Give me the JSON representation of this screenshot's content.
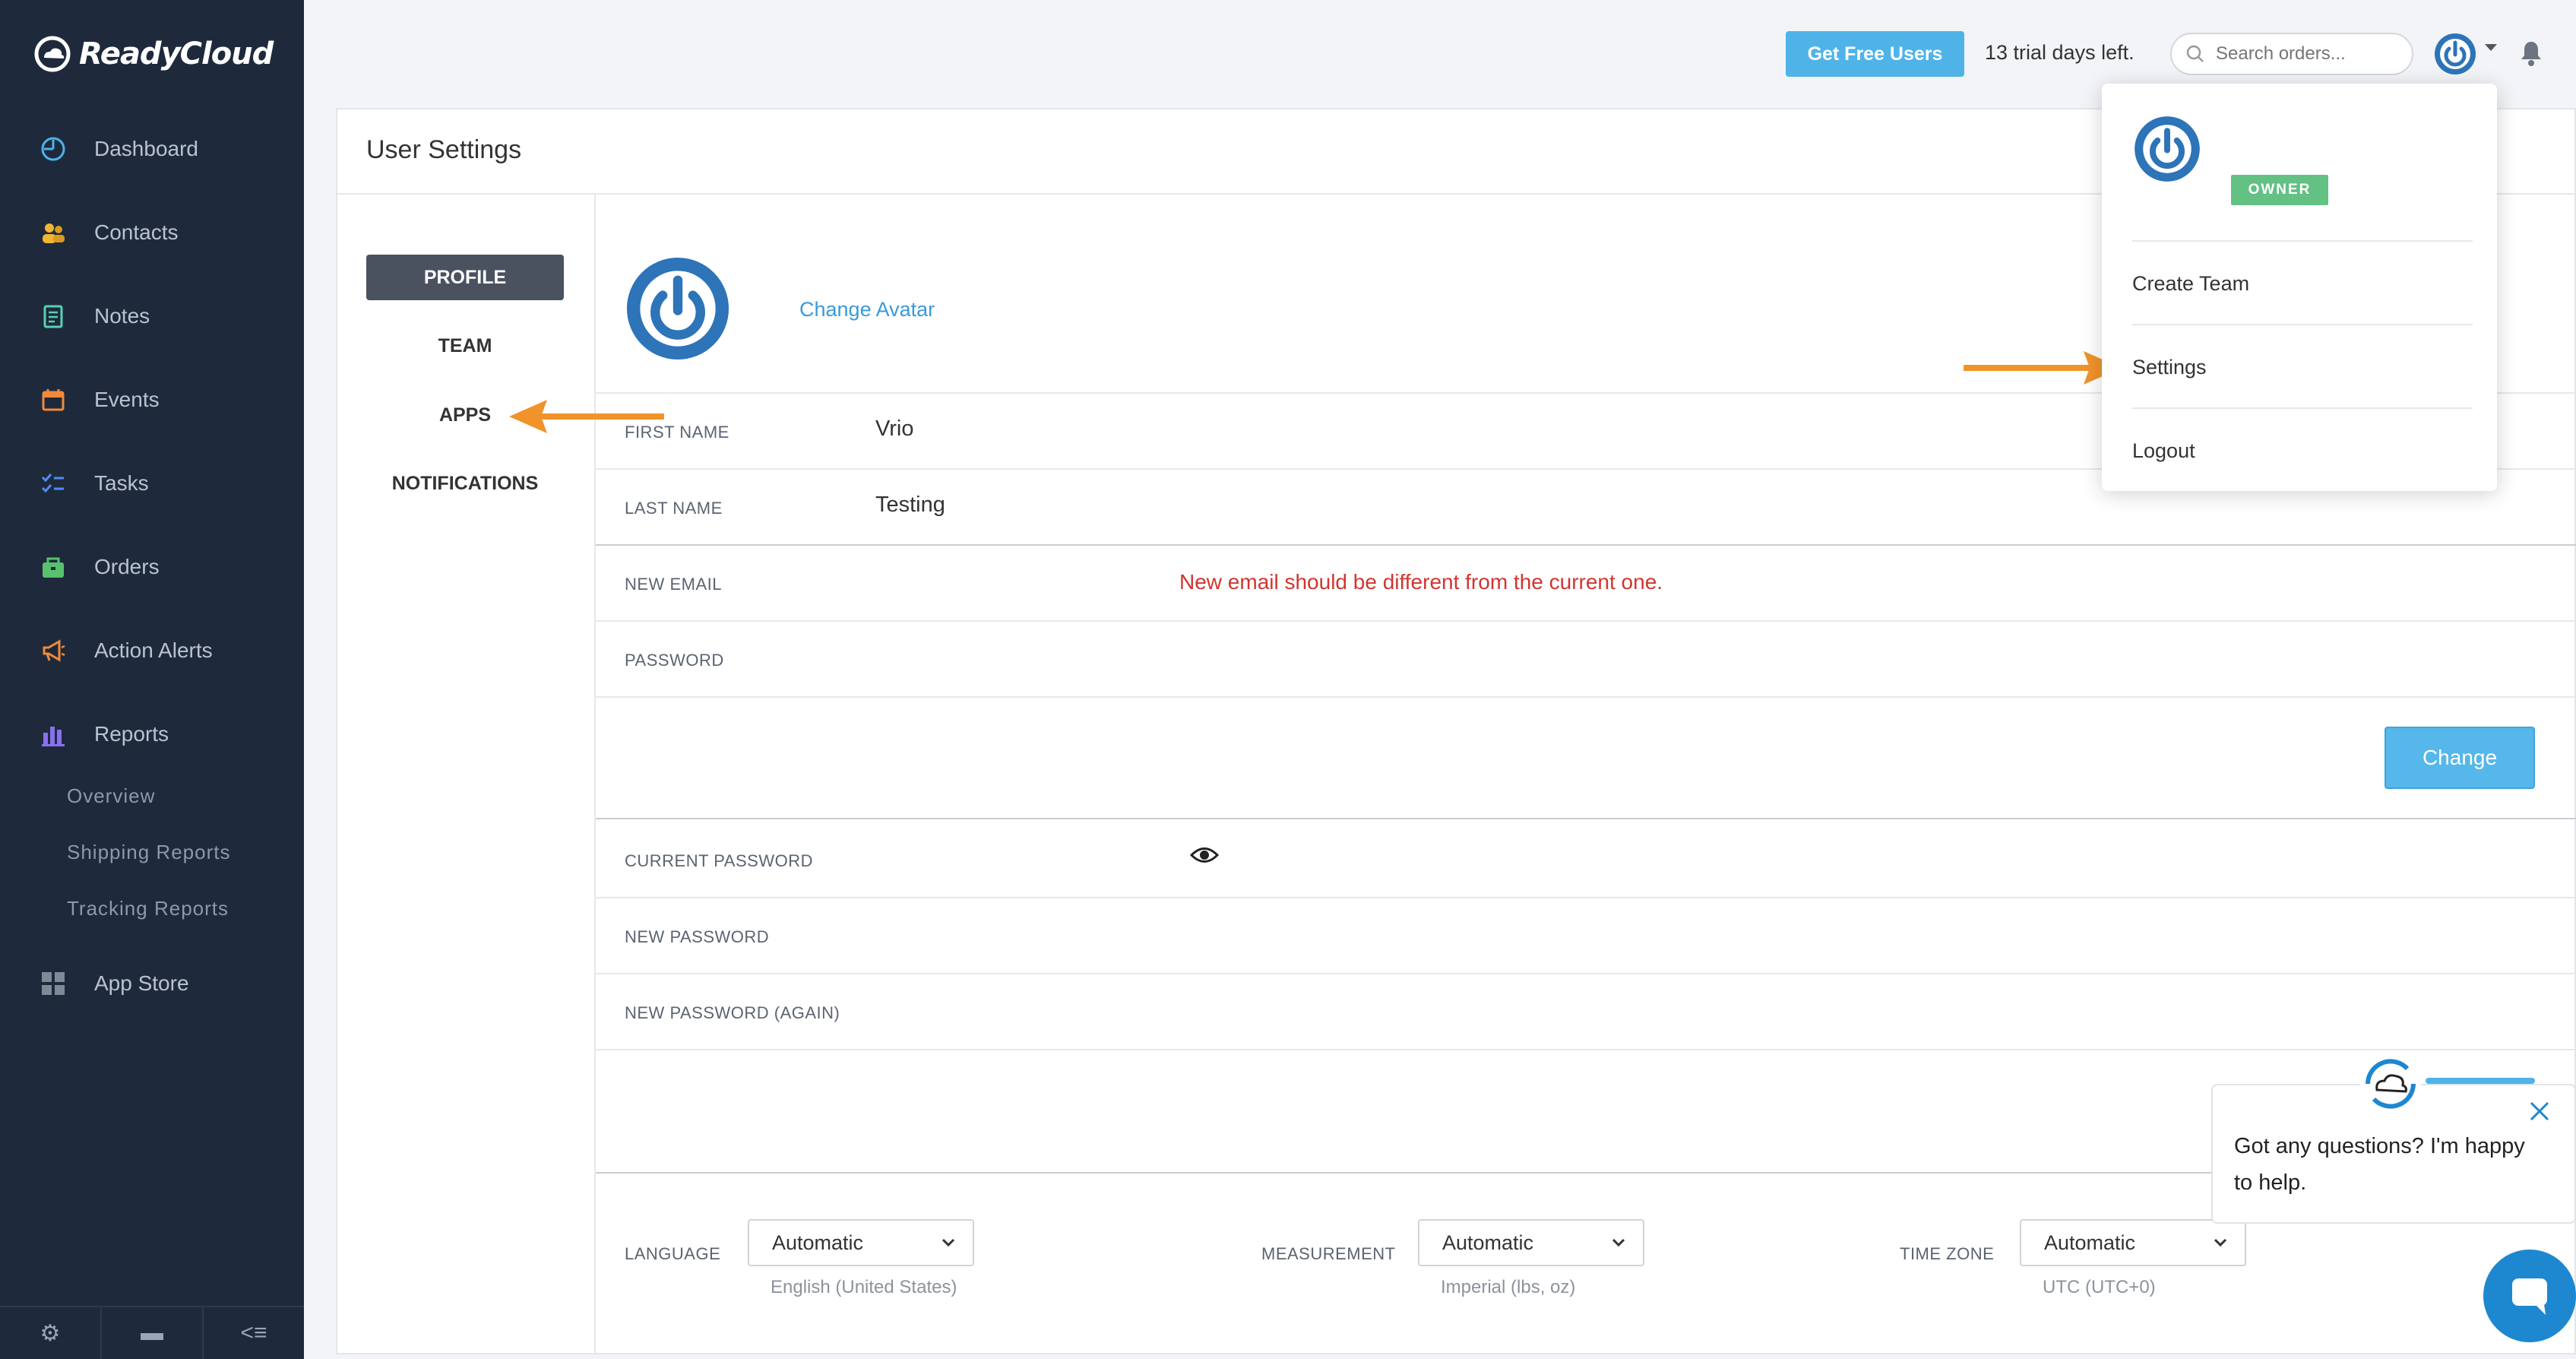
{
  "app": {
    "brand": "ReadyCloud"
  },
  "sidebar": {
    "items": [
      {
        "label": "Dashboard",
        "icon": "dashboard-icon"
      },
      {
        "label": "Contacts",
        "icon": "contacts-icon"
      },
      {
        "label": "Notes",
        "icon": "notes-icon"
      },
      {
        "label": "Events",
        "icon": "calendar-icon"
      },
      {
        "label": "Tasks",
        "icon": "tasks-icon"
      },
      {
        "label": "Orders",
        "icon": "orders-icon"
      },
      {
        "label": "Action Alerts",
        "icon": "megaphone-icon"
      },
      {
        "label": "Reports",
        "icon": "bar-chart-icon"
      },
      {
        "label": "App Store",
        "icon": "app-grid-icon"
      }
    ],
    "report_subitems": [
      "Overview",
      "Shipping Reports",
      "Tracking Reports"
    ],
    "bottom_glyphs": [
      "⚙",
      "▬",
      "<≡"
    ]
  },
  "header": {
    "free_users_button": "Get Free Users",
    "trial_text": "13 trial days left.",
    "search_placeholder": "Search orders..."
  },
  "settings": {
    "title": "User Settings",
    "tabs": [
      "PROFILE",
      "TEAM",
      "APPS",
      "NOTIFICATIONS"
    ],
    "active_tab": "PROFILE",
    "change_avatar": "Change Avatar",
    "fields": {
      "first_name_label": "FIRST NAME",
      "first_name_value": "Vrio",
      "last_name_label": "LAST NAME",
      "last_name_value": "Testing",
      "new_email_label": "NEW EMAIL",
      "email_error": "New email should be different from the current one.",
      "password_label": "PASSWORD",
      "change_button": "Change",
      "current_password_label": "CURRENT PASSWORD",
      "new_password_label": "NEW PASSWORD",
      "new_password_again_label": "NEW PASSWORD (AGAIN)"
    },
    "preferences": {
      "language_label": "LANGUAGE",
      "language_value": "Automatic",
      "language_help": "English (United States)",
      "measurement_label": "MEASUREMENT",
      "measurement_value": "Automatic",
      "measurement_help": "Imperial (lbs, oz)",
      "timezone_label": "TIME ZONE",
      "timezone_value": "Automatic",
      "timezone_help": "UTC (UTC+0)"
    }
  },
  "user_menu": {
    "badge": "OWNER",
    "items": [
      "Create Team",
      "Settings",
      "Logout"
    ]
  },
  "chat": {
    "message": "Got any questions? I'm happy to help."
  },
  "colors": {
    "sidebar_bg": "#1e2a3c",
    "accent_blue": "#4fb3e8",
    "annotation_arrow": "#f0932b",
    "error_red": "#d0362f",
    "owner_green": "#63c184"
  }
}
